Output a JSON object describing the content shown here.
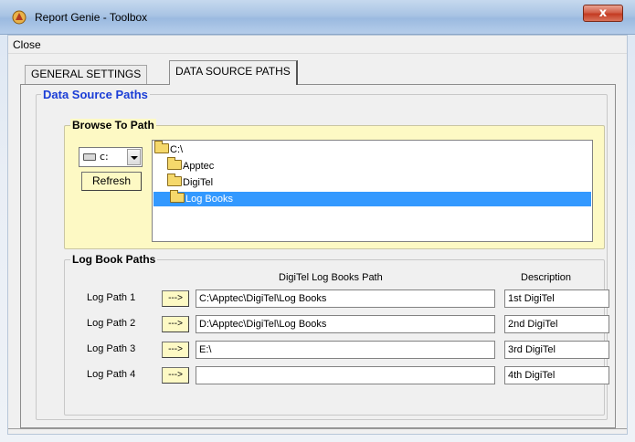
{
  "window": {
    "title": "Report Genie - Toolbox",
    "close_glyph": "x"
  },
  "menu": {
    "close_label": "Close"
  },
  "tabs": [
    {
      "label": "GENERAL SETTINGS",
      "active": false
    },
    {
      "label": "DATA SOURCE PATHS",
      "active": true
    }
  ],
  "data_source_paths": {
    "legend": "Data Source Paths",
    "legend_color": "#1a3dd6"
  },
  "browse": {
    "legend": "Browse To Path",
    "drive": "c:",
    "refresh_label": "Refresh",
    "background": "#fdf9c4",
    "directories": [
      {
        "name": "C:\\",
        "selected": false
      },
      {
        "name": "Apptec",
        "selected": false
      },
      {
        "name": "DigiTel",
        "selected": false
      },
      {
        "name": "Log Books",
        "selected": true
      }
    ],
    "selection_color": "#3399ff"
  },
  "log_books": {
    "legend": "Log Book Paths",
    "path_header": "DigiTel Log Books Path",
    "desc_header": "Description",
    "arrow_label": "--->",
    "rows": [
      {
        "label": "Log Path 1",
        "path": "C:\\Apptec\\DigiTel\\Log Books",
        "description": "1st DigiTel"
      },
      {
        "label": "Log Path 2",
        "path": "D:\\Apptec\\DigiTel\\Log Books",
        "description": "2nd DigiTel"
      },
      {
        "label": "Log Path 3",
        "path": "E:\\",
        "description": "3rd DigiTel"
      },
      {
        "label": "Log Path 4",
        "path": "",
        "description": "4th DigiTel"
      }
    ]
  }
}
